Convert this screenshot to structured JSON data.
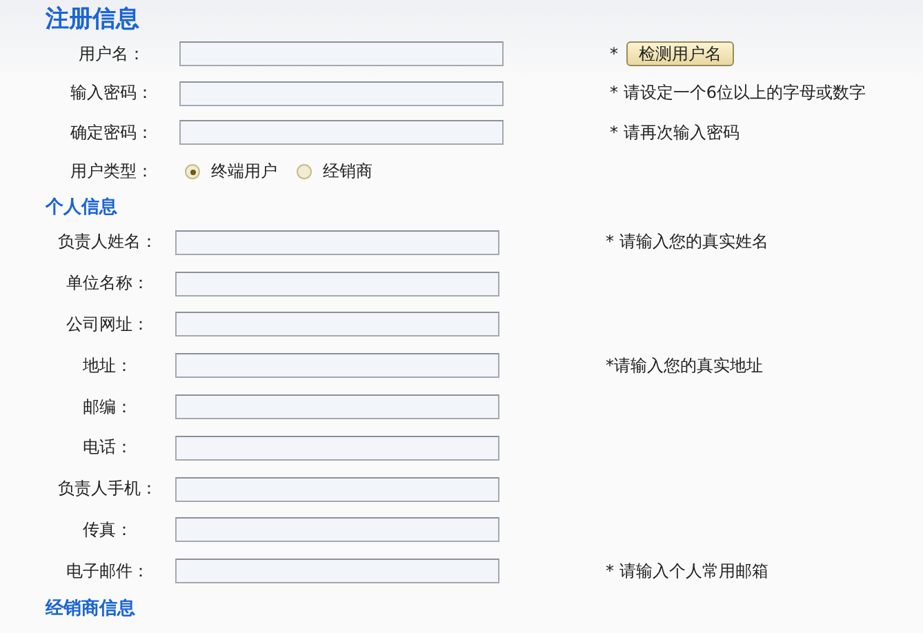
{
  "sections": [
    {
      "title": "注册信息",
      "rows": [
        {
          "kind": "field",
          "label": "用户名：",
          "note": "*",
          "button": "检测用户名"
        },
        {
          "kind": "field",
          "label": "输入密码：",
          "note": "* 请设定一个6位以上的字母或数字"
        },
        {
          "kind": "field",
          "label": "确定密码：",
          "note": "* 请再次输入密码"
        },
        {
          "kind": "radio",
          "label": "用户类型：",
          "options": [
            {
              "label": "终端用户",
              "selected": true
            },
            {
              "label": "经销商",
              "selected": false
            }
          ]
        }
      ]
    },
    {
      "title": "个人信息",
      "rows": [
        {
          "kind": "field",
          "label": "负责人姓名：",
          "note": "* 请输入您的真实姓名"
        },
        {
          "kind": "field",
          "label": "单位名称："
        },
        {
          "kind": "field",
          "label": "公司网址："
        },
        {
          "kind": "field",
          "label": "地址：",
          "note": "*请输入您的真实地址"
        },
        {
          "kind": "field",
          "label": "邮编："
        },
        {
          "kind": "field",
          "label": "电话："
        },
        {
          "kind": "field",
          "label": "负责人手机："
        },
        {
          "kind": "field",
          "label": "传真："
        },
        {
          "kind": "field",
          "label": "电子邮件：",
          "note": "* 请输入个人常用邮箱"
        }
      ]
    },
    {
      "title": "经销商信息"
    }
  ]
}
